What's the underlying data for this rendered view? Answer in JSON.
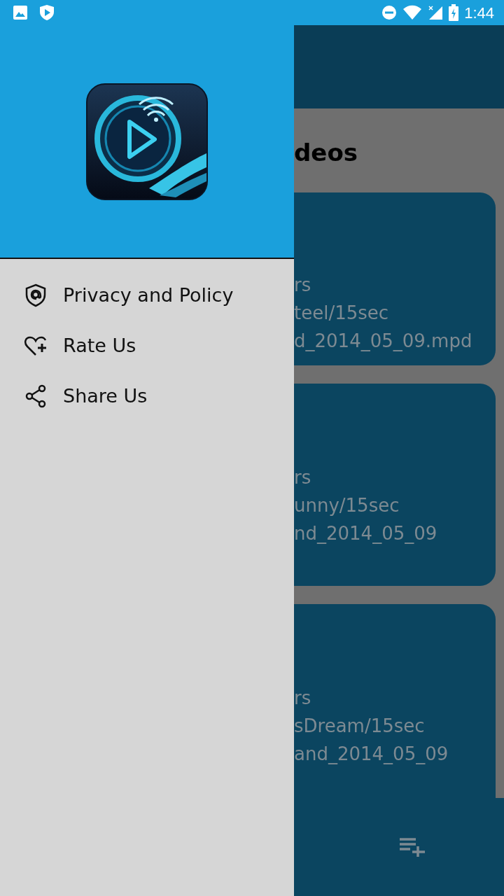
{
  "status_bar": {
    "time": "1:44"
  },
  "drawer": {
    "menu": [
      {
        "kind": "privacy",
        "label": "Privacy and Policy"
      },
      {
        "kind": "rate",
        "label": "Rate Us"
      },
      {
        "kind": "share",
        "label": "Share Us"
      }
    ]
  },
  "background_screen": {
    "title": "deos",
    "cards": [
      {
        "lines": [
          "rs",
          "teel/15sec",
          "d_2014_05_09.mpd"
        ]
      },
      {
        "lines": [
          "rs",
          "unny/15sec",
          "nd_2014_05_09"
        ]
      },
      {
        "lines": [
          "rs",
          "sDream/15sec",
          "and_2014_05_09"
        ]
      }
    ]
  }
}
